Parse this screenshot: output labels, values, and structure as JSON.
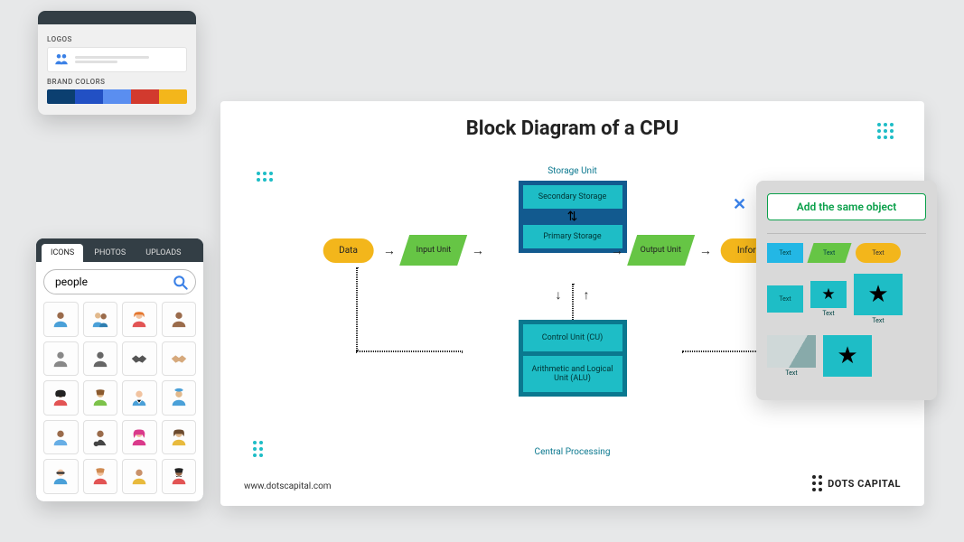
{
  "panels": {
    "logos": {
      "title": "LOGOS"
    },
    "brand": {
      "title": "BRAND COLORS",
      "swatches": [
        "#0b3f70",
        "#2250c4",
        "#5a8ef0",
        "#d23a2e",
        "#f3b61b"
      ]
    },
    "library": {
      "tabs": {
        "icons": "ICONS",
        "photos": "PHOTOS",
        "uploads": "UPLOADS"
      },
      "search_value": "people"
    }
  },
  "canvas": {
    "title": "Block Diagram of a CPU",
    "storage_label": "Storage Unit",
    "cpu_label": "Central Processing",
    "blocks": {
      "data": "Data",
      "input": "Input Unit",
      "secondary": "Secondary Storage",
      "primary": "Primary Storage",
      "output": "Output Unit",
      "info": "Information",
      "cu": "Control Unit (CU)",
      "alu": "Arithmetic and Logical Unit (ALU)"
    },
    "footer_url": "www.dotscapital.com",
    "footer_brand": "DOTS CAPITAL"
  },
  "inspector": {
    "add_button": "Add the same object",
    "text_label": "Text"
  }
}
